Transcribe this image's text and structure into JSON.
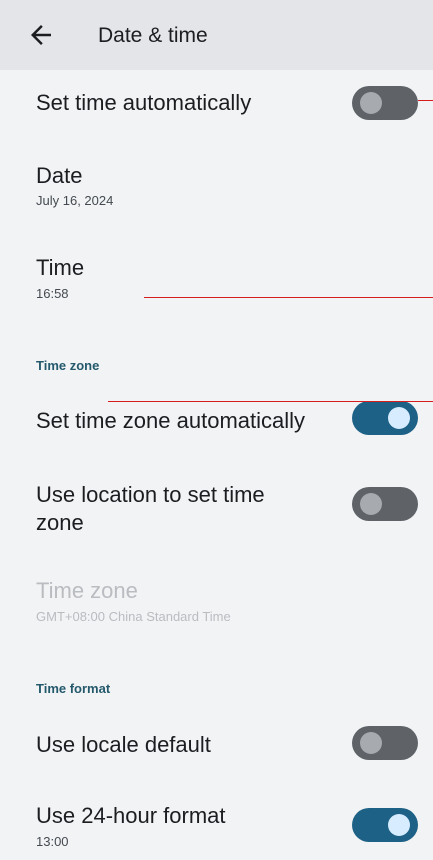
{
  "header": {
    "title": "Date & time"
  },
  "items": {
    "set_time_auto": {
      "label": "Set time automatically",
      "toggle": false
    },
    "date": {
      "label": "Date",
      "value": "July 16, 2024"
    },
    "time": {
      "label": "Time",
      "value": "16:58"
    },
    "section_timezone": "Time zone",
    "set_tz_auto": {
      "label": "Set time zone automatically",
      "toggle": true
    },
    "use_location": {
      "label_line1": "Use location to set time",
      "label_line2": "zone",
      "toggle": false
    },
    "time_zone": {
      "label": "Time zone",
      "value": "GMT+08:00 China Standard Time",
      "enabled": false
    },
    "section_format": "Time format",
    "use_locale_default": {
      "label": "Use locale default",
      "toggle": false
    },
    "use_24h": {
      "label": "Use 24-hour format",
      "value": "13:00",
      "toggle": true
    }
  },
  "colors": {
    "toggle_on": "#1d6186",
    "toggle_off": "#5f6368",
    "section_header": "#24596c",
    "annotation_line": "#d81b1b"
  }
}
